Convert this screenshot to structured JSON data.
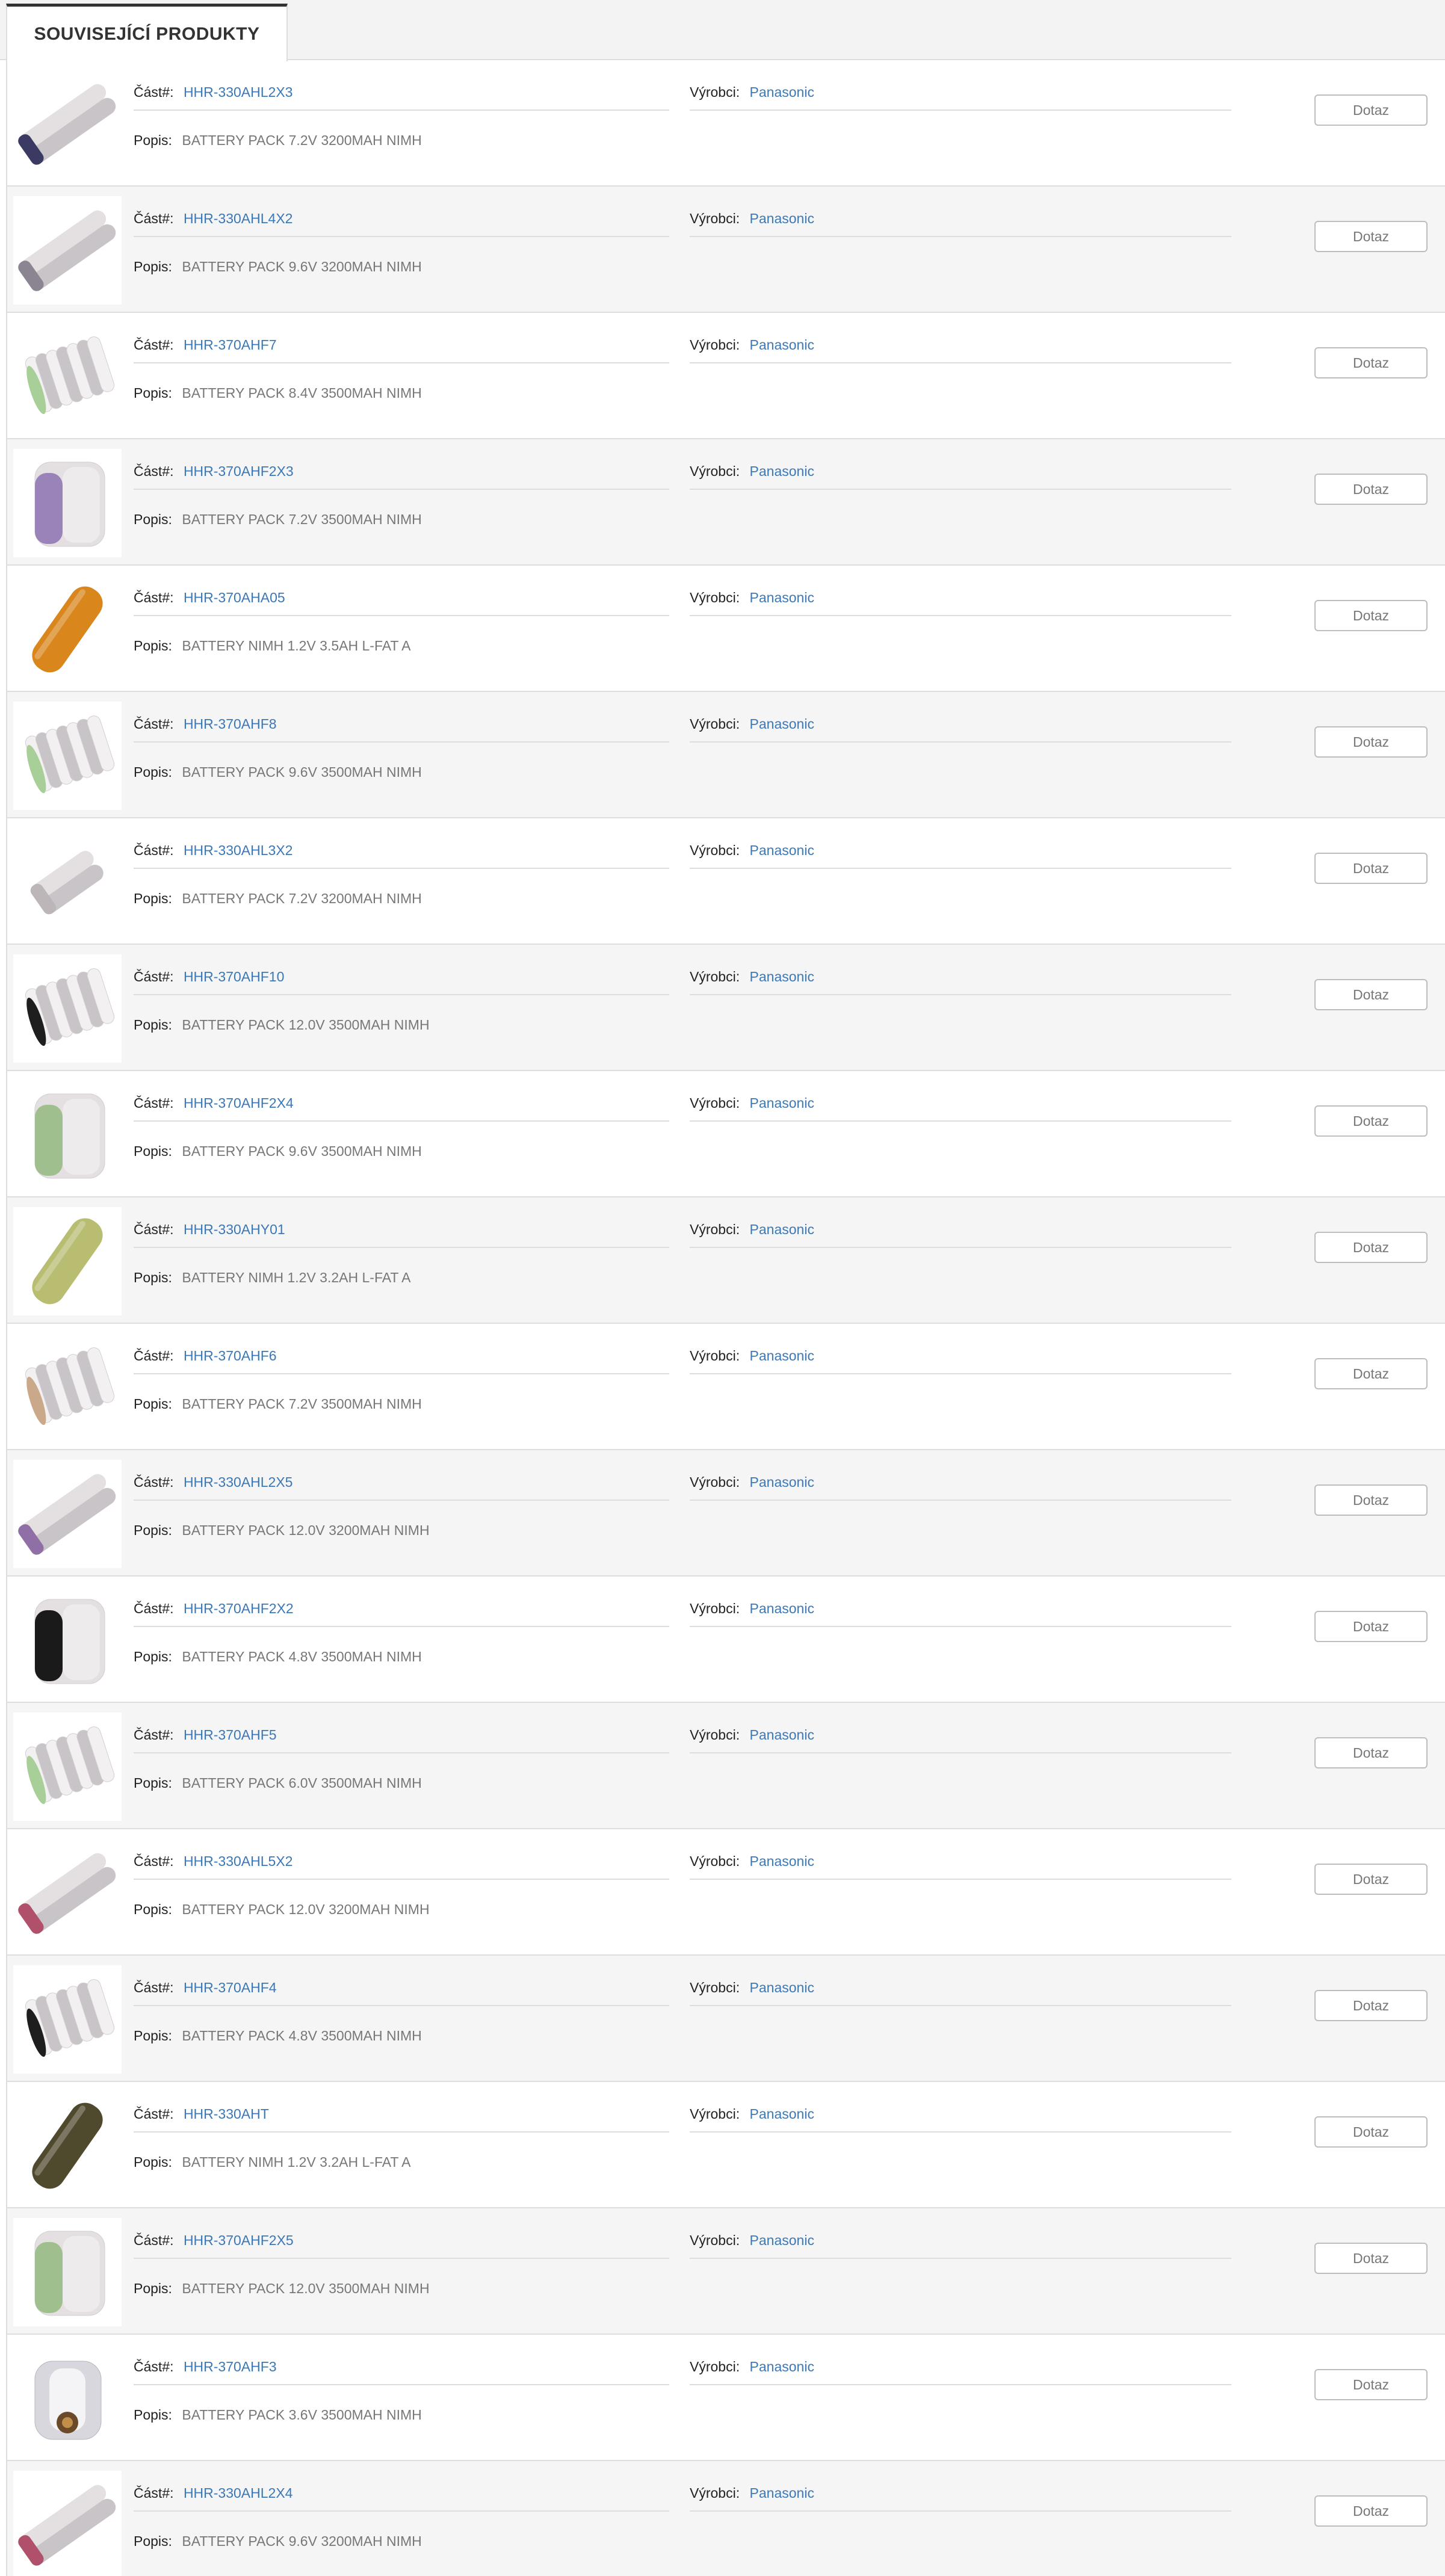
{
  "tabs": [
    {
      "label": "SOUVISEJÍCÍ PRODUKTY",
      "active": true
    }
  ],
  "labels": {
    "part": "Část#:",
    "description": "Popis:",
    "manufacturer": "Výrobci:",
    "button": "Dotaz"
  },
  "colors": {
    "link": "#3a78b8",
    "row_alt_bg": "#f5f5f5",
    "text_muted": "#777777"
  },
  "products": [
    {
      "part": "HHR-330AHL2X3",
      "manufacturer": "Panasonic",
      "description": "BATTERY PACK 7.2V 3200MAH NIMH",
      "image": "battery-stick-pack-dark-end"
    },
    {
      "part": "HHR-330AHL4X2",
      "manufacturer": "Panasonic",
      "description": "BATTERY PACK 9.6V 3200MAH NIMH",
      "image": "battery-stick-pack-long"
    },
    {
      "part": "HHR-370AHF7",
      "manufacturer": "Panasonic",
      "description": "BATTERY PACK 8.4V 3500MAH NIMH",
      "image": "battery-row-pack-green-end"
    },
    {
      "part": "HHR-370AHF2X3",
      "manufacturer": "Panasonic",
      "description": "BATTERY PACK 7.2V 3500MAH NIMH",
      "image": "battery-block-pack-purple"
    },
    {
      "part": "HHR-370AHA05",
      "manufacturer": "Panasonic",
      "description": "BATTERY NIMH 1.2V 3.5AH L-FAT A",
      "image": "battery-cell-orange"
    },
    {
      "part": "HHR-370AHF8",
      "manufacturer": "Panasonic",
      "description": "BATTERY PACK 9.6V 3500MAH NIMH",
      "image": "battery-row-pack-green-end"
    },
    {
      "part": "HHR-330AHL3X2",
      "manufacturer": "Panasonic",
      "description": "BATTERY PACK 7.2V 3200MAH NIMH",
      "image": "battery-stick-pack-short"
    },
    {
      "part": "HHR-370AHF10",
      "manufacturer": "Panasonic",
      "description": "BATTERY PACK 12.0V 3500MAH NIMH",
      "image": "battery-row-pack-black-end"
    },
    {
      "part": "HHR-370AHF2X4",
      "manufacturer": "Panasonic",
      "description": "BATTERY PACK 9.6V 3500MAH NIMH",
      "image": "battery-block-pack-green"
    },
    {
      "part": "HHR-330AHY01",
      "manufacturer": "Panasonic",
      "description": "BATTERY NIMH 1.2V 3.2AH L-FAT A",
      "image": "battery-cell-olive"
    },
    {
      "part": "HHR-370AHF6",
      "manufacturer": "Panasonic",
      "description": "BATTERY PACK 7.2V 3500MAH NIMH",
      "image": "battery-row-pack-tan-end"
    },
    {
      "part": "HHR-330AHL2X5",
      "manufacturer": "Panasonic",
      "description": "BATTERY PACK 12.0V 3200MAH NIMH",
      "image": "battery-stick-pack-purple-end"
    },
    {
      "part": "HHR-370AHF2X2",
      "manufacturer": "Panasonic",
      "description": "BATTERY PACK 4.8V 3500MAH NIMH",
      "image": "battery-block-pack-black"
    },
    {
      "part": "HHR-370AHF5",
      "manufacturer": "Panasonic",
      "description": "BATTERY PACK 6.0V 3500MAH NIMH",
      "image": "battery-row-pack-green-end"
    },
    {
      "part": "HHR-330AHL5X2",
      "manufacturer": "Panasonic",
      "description": "BATTERY PACK 12.0V 3200MAH NIMH",
      "image": "battery-stick-pack-red-end"
    },
    {
      "part": "HHR-370AHF4",
      "manufacturer": "Panasonic",
      "description": "BATTERY PACK 4.8V 3500MAH NIMH",
      "image": "battery-row-pack-black-end"
    },
    {
      "part": "HHR-330AHT",
      "manufacturer": "Panasonic",
      "description": "BATTERY NIMH 1.2V 3.2AH L-FAT A",
      "image": "battery-cell-dark-olive"
    },
    {
      "part": "HHR-370AHF2X5",
      "manufacturer": "Panasonic",
      "description": "BATTERY PACK 12.0V 3500MAH NIMH",
      "image": "battery-block-pack-green"
    },
    {
      "part": "HHR-370AHF3",
      "manufacturer": "Panasonic",
      "description": "BATTERY PACK 3.6V 3500MAH NIMH",
      "image": "battery-triangle-pack"
    },
    {
      "part": "HHR-330AHL2X4",
      "manufacturer": "Panasonic",
      "description": "BATTERY PACK 9.6V 3200MAH NIMH",
      "image": "battery-stick-pack-red-end"
    }
  ]
}
